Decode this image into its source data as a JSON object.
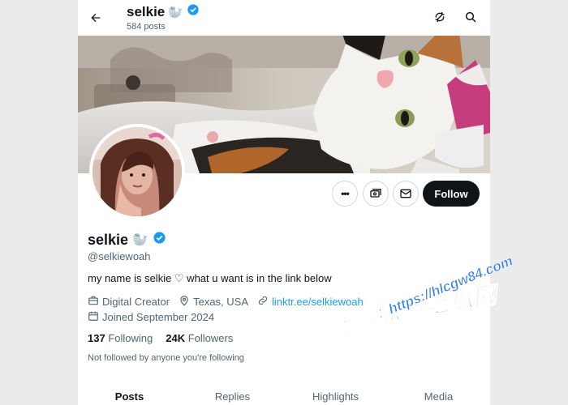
{
  "header": {
    "title": "selkie",
    "title_emoji": "🦭",
    "posts_count": "584 posts"
  },
  "profile": {
    "display_name": "selkie",
    "name_emoji": "🦭",
    "handle": "@selkiewoah",
    "bio": "my name is selkie ♡ what u want is in the link below",
    "category": "Digital Creator",
    "location": "Texas, USA",
    "website": "linktr.ee/selkiewoah",
    "joined": "Joined September 2024",
    "following_count": "137",
    "following_label": "Following",
    "followers_count": "24K",
    "followers_label": "Followers",
    "not_followed_text": "Not followed by anyone you're following"
  },
  "actions": {
    "more_label": "•••",
    "follow_label": "Follow"
  },
  "tabs": [
    {
      "label": "Posts",
      "active": true
    },
    {
      "label": "Replies",
      "active": false
    },
    {
      "label": "Highlights",
      "active": false
    },
    {
      "label": "Media",
      "active": false
    }
  ],
  "watermark": {
    "line1": "黑料吃瓜网",
    "line2": "看完整版：https://hlcgw84.com"
  },
  "icons": [
    "back-arrow-icon",
    "refresh-icon",
    "search-icon",
    "verified-badge-icon",
    "more-icon",
    "subscribe-icon",
    "message-icon",
    "briefcase-icon",
    "location-pin-icon",
    "link-icon",
    "calendar-icon"
  ],
  "colors": {
    "accent": "#1d9bf0",
    "follow_button": "#0f1419",
    "muted_text": "#536471",
    "watermark": "#2f7bf0"
  }
}
